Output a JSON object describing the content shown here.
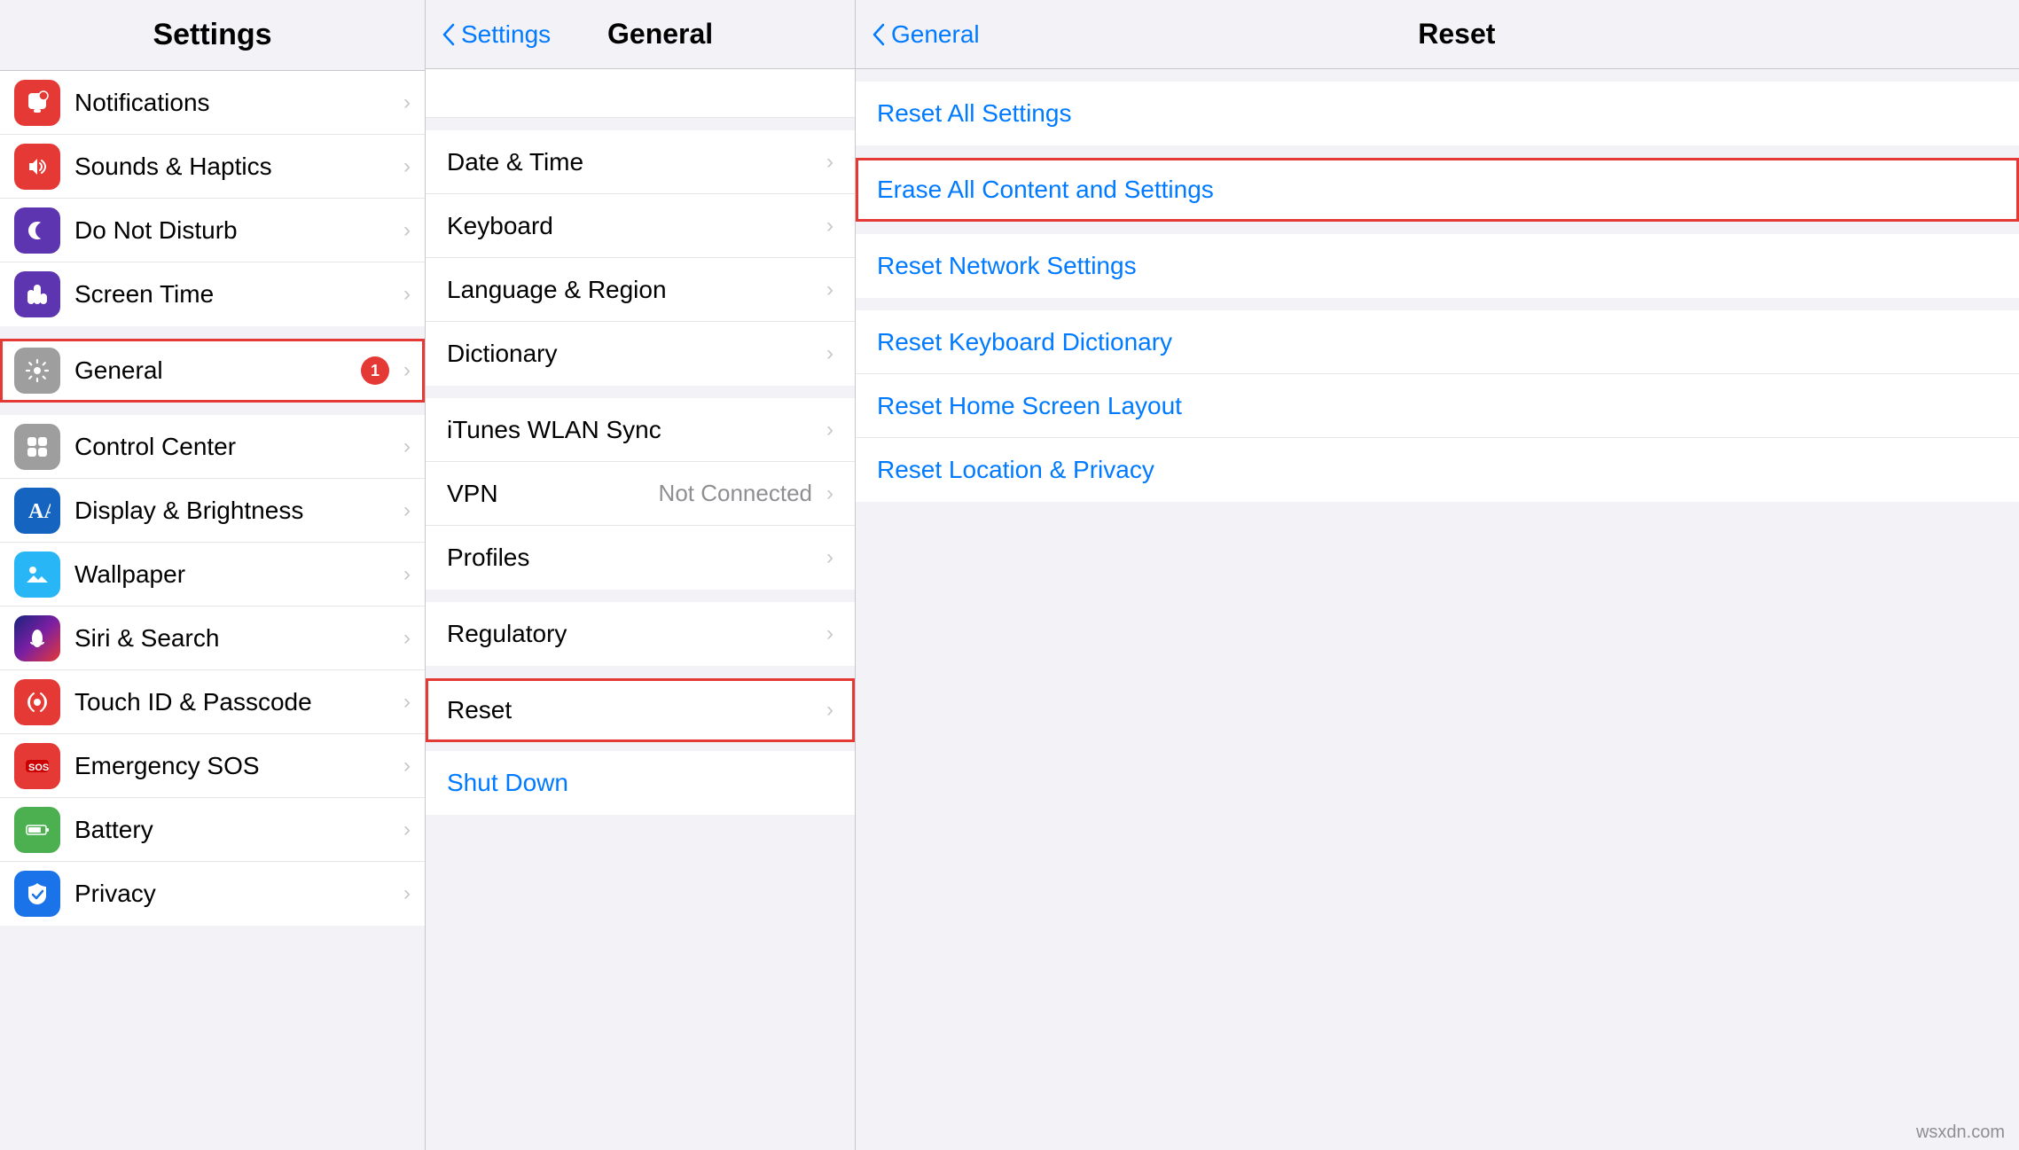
{
  "left_column": {
    "title": "Settings",
    "groups": [
      {
        "items": [
          {
            "id": "notifications",
            "label": "Notifications",
            "icon_color": "#e53935",
            "icon": "notifications"
          },
          {
            "id": "sounds",
            "label": "Sounds & Haptics",
            "icon_color": "#e53935",
            "icon": "sounds"
          },
          {
            "id": "donotdisturb",
            "label": "Do Not Disturb",
            "icon_color": "#5e35b1",
            "icon": "moon"
          },
          {
            "id": "screentime",
            "label": "Screen Time",
            "icon_color": "#5e35b1",
            "icon": "hourglass"
          }
        ]
      },
      {
        "items": [
          {
            "id": "general",
            "label": "General",
            "icon_color": "#9e9e9e",
            "icon": "gear",
            "badge": "1",
            "selected": true
          }
        ]
      },
      {
        "items": [
          {
            "id": "controlcenter",
            "label": "Control Center",
            "icon_color": "#9e9e9e",
            "icon": "controlcenter"
          },
          {
            "id": "displaybrightness",
            "label": "Display & Brightness",
            "icon_color": "#1565c0",
            "icon": "display"
          },
          {
            "id": "wallpaper",
            "label": "Wallpaper",
            "icon_color": "#29b6f6",
            "icon": "wallpaper"
          },
          {
            "id": "sirisearch",
            "label": "Siri & Search",
            "icon_color": "#1a237e",
            "icon": "siri"
          },
          {
            "id": "touchid",
            "label": "Touch ID & Passcode",
            "icon_color": "#e53935",
            "icon": "fingerprint"
          },
          {
            "id": "emergencysos",
            "label": "Emergency SOS",
            "icon_color": "#e53935",
            "icon": "sos"
          },
          {
            "id": "battery",
            "label": "Battery",
            "icon_color": "#4caf50",
            "icon": "battery"
          },
          {
            "id": "privacy",
            "label": "Privacy",
            "icon_color": "#1a73e8",
            "icon": "hand"
          }
        ]
      }
    ]
  },
  "middle_column": {
    "back_label": "Settings",
    "title": "General",
    "groups": [
      {
        "items": [
          {
            "id": "partial",
            "partial": true
          }
        ]
      },
      {
        "items": [
          {
            "id": "datetime",
            "label": "Date & Time"
          },
          {
            "id": "keyboard",
            "label": "Keyboard"
          },
          {
            "id": "language",
            "label": "Language & Region"
          },
          {
            "id": "dictionary",
            "label": "Dictionary"
          }
        ]
      },
      {
        "items": [
          {
            "id": "itunes",
            "label": "iTunes WLAN Sync"
          },
          {
            "id": "vpn",
            "label": "VPN",
            "value": "Not Connected"
          },
          {
            "id": "profiles",
            "label": "Profiles"
          }
        ]
      },
      {
        "items": [
          {
            "id": "regulatory",
            "label": "Regulatory"
          }
        ]
      },
      {
        "items": [
          {
            "id": "reset",
            "label": "Reset",
            "selected": true
          }
        ]
      },
      {
        "items": [
          {
            "id": "shutdown",
            "label": "Shut Down",
            "link": true
          }
        ]
      }
    ]
  },
  "right_column": {
    "back_label": "General",
    "title": "Reset",
    "groups": [
      {
        "items": [
          {
            "id": "resetallsettings",
            "label": "Reset All Settings"
          }
        ]
      },
      {
        "items": [
          {
            "id": "eraseall",
            "label": "Erase All Content and Settings",
            "selected": true
          }
        ]
      },
      {
        "items": [
          {
            "id": "resetnetwork",
            "label": "Reset Network Settings"
          }
        ]
      },
      {
        "items": [
          {
            "id": "resetkeyboard",
            "label": "Reset Keyboard Dictionary"
          },
          {
            "id": "resethomescreen",
            "label": "Reset Home Screen Layout"
          },
          {
            "id": "resetlocation",
            "label": "Reset Location & Privacy"
          }
        ]
      }
    ]
  },
  "watermark": "wsxdn.com"
}
